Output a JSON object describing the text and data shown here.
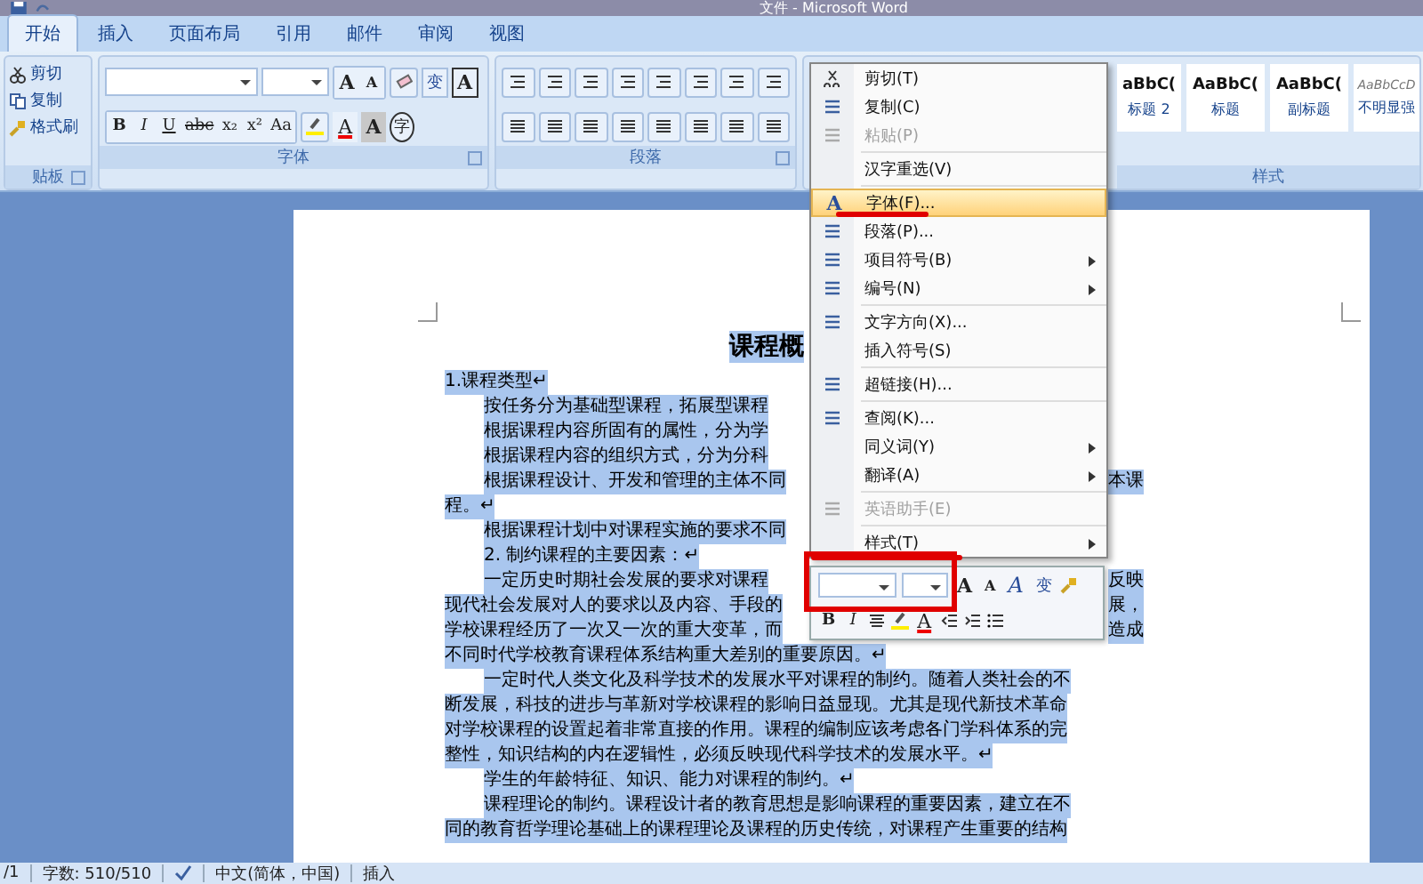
{
  "window": {
    "title": "文件 - Microsoft Word"
  },
  "tabs": [
    {
      "label": "开始",
      "selected": true
    },
    {
      "label": "插入",
      "selected": false
    },
    {
      "label": "页面布局",
      "selected": false
    },
    {
      "label": "引用",
      "selected": false
    },
    {
      "label": "邮件",
      "selected": false
    },
    {
      "label": "审阅",
      "selected": false
    },
    {
      "label": "视图",
      "selected": false
    }
  ],
  "clipboard": {
    "label": "贴板",
    "items": [
      "剪切",
      "复制",
      "格式刷"
    ]
  },
  "font_group": {
    "label": "字体",
    "row1": [
      "A",
      "A",
      "变",
      "A"
    ],
    "row2": [
      "B",
      "I",
      "U",
      "abc",
      "x₂",
      "x²",
      "Aa",
      "A",
      "A",
      "字"
    ]
  },
  "paragraph_group": {
    "label": "段落"
  },
  "styles_group": {
    "label": "样式",
    "items": [
      {
        "preview": "aBbC(",
        "label": "标题 2",
        "subtle": false
      },
      {
        "preview": "AaBbC(",
        "label": "标题",
        "subtle": false
      },
      {
        "preview": "AaBbC(",
        "label": "副标题",
        "subtle": false
      },
      {
        "preview": "AaBbCcD",
        "label": "不明显强",
        "subtle": true
      }
    ]
  },
  "document": {
    "selected": true,
    "title": "课程概",
    "lines": [
      {
        "text": "1.课程类型↵",
        "indented": false
      },
      {
        "text": "按任务分为基础型课程，拓展型课程",
        "indented": true
      },
      {
        "text": "根据课程内容所固有的属性，分为学",
        "indented": true
      },
      {
        "text": "根据课程内容的组织方式，分为分科",
        "indented": true
      },
      {
        "text": "根据课程设计、开发和管理的主体不同",
        "indented": true,
        "right_text": "本课"
      },
      {
        "text": "程。↵",
        "indented": false
      },
      {
        "text": "根据课程计划中对课程实施的要求不同",
        "indented": true
      },
      {
        "text": "2. 制约课程的主要因素：↵",
        "indented": true
      },
      {
        "text": "一定历史时期社会发展的要求对课程",
        "indented": true,
        "right_text": "反映"
      },
      {
        "text": "现代社会发展对人的要求以及内容、手段的",
        "indented": false,
        "right_text": "展，"
      },
      {
        "text": "学校课程经历了一次又一次的重大变革，而",
        "indented": false,
        "right_text": "造成"
      },
      {
        "text": "不同时代学校教育课程体系结构重大差别的重要原因。↵",
        "indented": false
      },
      {
        "text": "一定时代人类文化及科学技术的发展水平对课程的制约。随着人类社会的不",
        "indented": true
      },
      {
        "text": "断发展，科技的进步与革新对学校课程的影响日益显现。尤其是现代新技术革命",
        "indented": false
      },
      {
        "text": "对学校课程的设置起着非常直接的作用。课程的编制应该考虑各门学科体系的完",
        "indented": false
      },
      {
        "text": "整性，知识结构的内在逻辑性，必须反映现代科学技术的发展水平。↵",
        "indented": false
      },
      {
        "text": "学生的年龄特征、知识、能力对课程的制约。↵",
        "indented": true
      },
      {
        "text": "课程理论的制约。课程设计者的教育思想是影响课程的重要因素，建立在不",
        "indented": true
      },
      {
        "text": "同的教育哲学理论基础上的课程理论及课程的历史传统，对课程产生重要的结构",
        "indented": false
      }
    ]
  },
  "context_menu": {
    "items": [
      {
        "kind": "item",
        "label": "剪切(T)",
        "disabled": false,
        "selected": false,
        "submenu": false
      },
      {
        "kind": "item",
        "label": "复制(C)",
        "disabled": false,
        "selected": false,
        "submenu": false
      },
      {
        "kind": "item",
        "label": "粘贴(P)",
        "disabled": true,
        "selected": false,
        "submenu": false
      },
      {
        "kind": "separator"
      },
      {
        "kind": "item",
        "label": "汉字重选(V)",
        "disabled": false,
        "selected": false,
        "submenu": false
      },
      {
        "kind": "separator"
      },
      {
        "kind": "item",
        "label": "字体(F)...",
        "disabled": false,
        "selected": true,
        "submenu": false,
        "icon_text": "A"
      },
      {
        "kind": "item",
        "label": "段落(P)...",
        "disabled": false,
        "selected": false,
        "submenu": false
      },
      {
        "kind": "item",
        "label": "项目符号(B)",
        "disabled": false,
        "selected": false,
        "submenu": true
      },
      {
        "kind": "item",
        "label": "编号(N)",
        "disabled": false,
        "selected": false,
        "submenu": true
      },
      {
        "kind": "separator"
      },
      {
        "kind": "item",
        "label": "文字方向(X)...",
        "disabled": false,
        "selected": false,
        "submenu": false
      },
      {
        "kind": "item",
        "label": "插入符号(S)",
        "disabled": false,
        "selected": false,
        "submenu": false
      },
      {
        "kind": "separator"
      },
      {
        "kind": "item",
        "label": "超链接(H)...",
        "disabled": false,
        "selected": false,
        "submenu": false
      },
      {
        "kind": "separator"
      },
      {
        "kind": "item",
        "label": "查阅(K)...",
        "disabled": false,
        "selected": false,
        "submenu": false
      },
      {
        "kind": "item",
        "label": "同义词(Y)",
        "disabled": false,
        "selected": false,
        "submenu": true
      },
      {
        "kind": "item",
        "label": "翻译(A)",
        "disabled": false,
        "selected": false,
        "submenu": true
      },
      {
        "kind": "separator"
      },
      {
        "kind": "item",
        "label": "英语助手(E)",
        "disabled": true,
        "selected": false,
        "submenu": false
      },
      {
        "kind": "separator"
      },
      {
        "kind": "item",
        "label": "样式(T)",
        "disabled": false,
        "selected": false,
        "submenu": true
      }
    ]
  },
  "mini_toolbar": {
    "row1": [
      "A",
      "A",
      "A",
      "变"
    ],
    "row2": [
      "B",
      "I",
      "A"
    ]
  },
  "status_bar": {
    "page": "/1",
    "word_count": "字数: 510/510",
    "language": "中文(简体，中国)",
    "mode": "插入"
  }
}
